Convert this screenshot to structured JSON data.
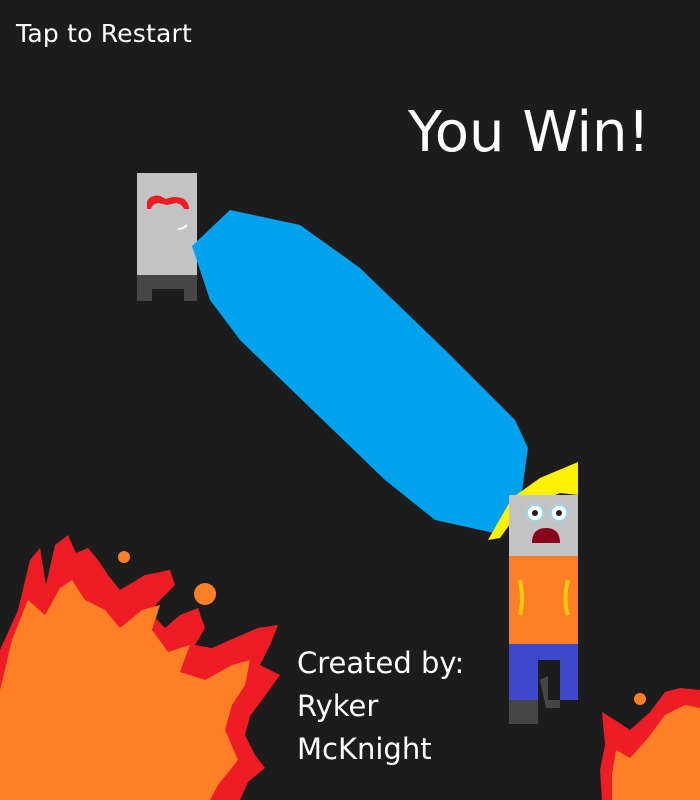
{
  "hud": {
    "restart_label": "Tap to Restart"
  },
  "result": {
    "title": "You Win!"
  },
  "credits": {
    "line1": "Created by:",
    "line2": "Ryker",
    "line3": "McKnight"
  },
  "colors": {
    "background": "#1c1c1c",
    "water_stream": "#00a2ed",
    "flame_outer": "#ee1c24",
    "flame_inner": "#ff7f27",
    "hero_shirt": "#ff7f27",
    "hero_pants": "#3f48cc",
    "hero_hair": "#fff200",
    "enemy_body": "#c3c3c3",
    "enemy_legs": "#464646",
    "enemy_brow": "#ed1c24"
  }
}
